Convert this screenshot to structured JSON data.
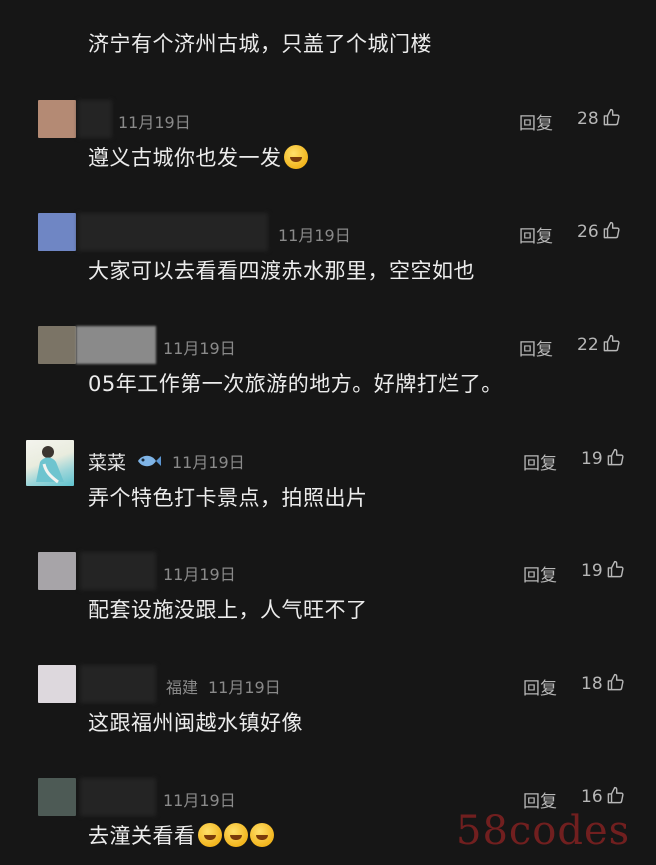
{
  "top_comment": {
    "text": "济宁有个济州古城，只盖了个城门楼"
  },
  "reply_label": "回复",
  "comments": [
    {
      "date": "11月19日",
      "text": "遵义古城你也发一发",
      "likes": "28",
      "avatar_color": "#b48a74"
    },
    {
      "date": "11月19日",
      "text": "大家可以去看看四渡赤水那里，空空如也",
      "likes": "26",
      "avatar_color": "#6f86c4"
    },
    {
      "date": "11月19日",
      "text": "05年工作第一次旅游的地方。好牌打烂了。",
      "likes": "22",
      "avatar_color": "#7b7466"
    },
    {
      "username": "菜菜",
      "date": "11月19日",
      "text": "弄个特色打卡景点，拍照出片",
      "likes": "19"
    },
    {
      "date": "11月19日",
      "text": "配套设施没跟上，人气旺不了",
      "likes": "19",
      "avatar_color": "#a7a4a8"
    },
    {
      "location": "福建",
      "date": "11月19日",
      "text": "这跟福州闽越水镇好像",
      "likes": "18",
      "avatar_color": "#ddd8dd"
    },
    {
      "date": "11月19日",
      "text": "去潼关看看",
      "likes": "16",
      "avatar_color": "#4d5a55"
    }
  ],
  "watermark": "58codes"
}
